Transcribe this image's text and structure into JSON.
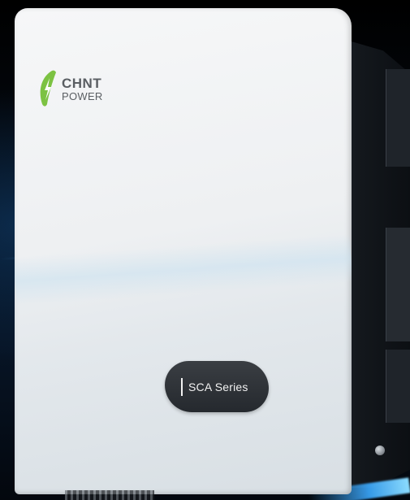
{
  "product": {
    "brand_line1": "CHNT",
    "brand_line2": "POWER",
    "series_label": "SCA Series"
  },
  "icons": {
    "brand_logo": "leaf-lightning-icon"
  },
  "colors": {
    "brand_green": "#7cc242",
    "panel_white": "#f2f3f4",
    "badge_dark": "#2e3237",
    "accent_blue": "#3aa8ff"
  }
}
